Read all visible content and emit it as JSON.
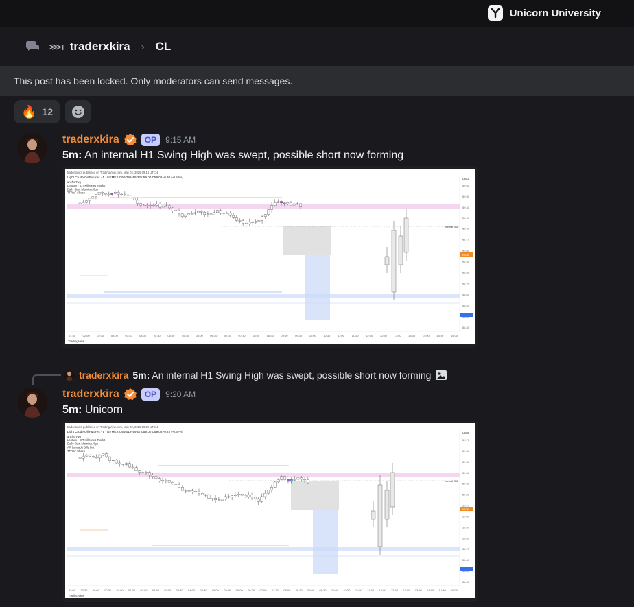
{
  "brand": {
    "name": "Unicorn University"
  },
  "breadcrumb": {
    "thread_glyph": "⋙ ı",
    "channel": "traderxkira",
    "separator": "›",
    "thread": "CL"
  },
  "locked_banner": {
    "text": "This post has been locked. Only moderators can send messages."
  },
  "reactions": [
    {
      "emoji": "🔥",
      "count": "12"
    }
  ],
  "messages": [
    {
      "author": "traderxkira",
      "badge": "OP",
      "time": "9:15 AM",
      "bold": "5m:",
      "text": "An internal H1 Swing High was swept, possible short now forming",
      "chart": {
        "header": "tradersxkira published on TradingView.com, May 02, 2025 09:14 UTC-4",
        "instrument": "Light Crude Oil Futures · 5 · NYMEX  O59.29  H59.32  L59.00  C59.06  -0.30 (-0.51%)",
        "legend": [
          "anchorFvg",
          "Lentum - ICT Killzones Toolkit",
          "Daily Start Morning Algo",
          "TTRaF Shock"
        ],
        "xlabels": [
          "01:30",
          "02:00",
          "02:30",
          "03:00",
          "03:30",
          "04:00",
          "04:30",
          "05:00",
          "05:30",
          "06:00",
          "06:30",
          "07:00",
          "07:30",
          "08:00",
          "08:30",
          "09:00",
          "09:30",
          "10:00",
          "10:30",
          "11:00",
          "11:30",
          "12:00",
          "12:30",
          "13:00",
          "13:30",
          "14:00",
          "14:30",
          "15:00"
        ],
        "ylabels": [
          "59.60",
          "59.50",
          "59.40",
          "59.30",
          "59.20",
          "59.10",
          "59.00",
          "58.90",
          "58.80",
          "58.70",
          "58.60",
          "58.50",
          "58.40",
          "58.30"
        ],
        "internal_label": "internal ERL",
        "footer": "TradingView",
        "usd": "USD",
        "price_tag": "59.06"
      }
    },
    {
      "author": "traderxkira",
      "badge": "OP",
      "time": "9:20 AM",
      "bold": "5m:",
      "text": "Unicorn",
      "reply": {
        "author": "traderxkira",
        "bold": "5m:",
        "text": "An internal H1 Swing High was swept, possible short now forming"
      },
      "chart": {
        "header": "tradersxkira published on TradingView.com, May 02, 2025 09:20 UTC-4",
        "instrument": "Light Crude Oil Futures · 5 · NYMEX  O59.01  H59.07  L59.00  C59.06  -0.22 (-0.37%)",
        "legend": [
          "anchorFvg",
          "Lentum - ICT Killzones Toolkit",
          "Daily Start Morning Algo",
          "AR Lanzado Silly Bot",
          "TTRaF Shock"
        ],
        "xlabels": [
          "22:00",
          "23:30",
          "00:00",
          "00:30",
          "01:00",
          "01:30",
          "02:00",
          "02:30",
          "03:00",
          "03:30",
          "04:00",
          "04:30",
          "05:00",
          "05:30",
          "06:00",
          "06:30",
          "07:00",
          "07:30",
          "08:00",
          "08:30",
          "09:00",
          "09:30",
          "10:00",
          "10:30",
          "11:00",
          "11:30",
          "12:00",
          "12:30",
          "13:00",
          "13:30",
          "14:00",
          "14:30",
          "15:00"
        ],
        "ylabels": [
          "59.70",
          "59.60",
          "59.50",
          "59.40",
          "59.30",
          "59.20",
          "59.10",
          "59.00",
          "58.90",
          "58.80",
          "58.70",
          "58.60",
          "58.50",
          "58.40"
        ],
        "internal_label": "internal ERL",
        "footer": "TradingView",
        "usd": "USD",
        "price_tag": "59.06"
      }
    }
  ],
  "colors": {
    "author": "#f28c38",
    "op_badge": "#5865f2",
    "candle_up": "#ffffff",
    "candle_edge": "#555555",
    "pink_zone": "#f3d6f0",
    "blue_zone": "#dbe6fb",
    "fvg_gray": "#d9d9d9",
    "magenta_candle": "#c04fd6",
    "teal_candle": "#26c6da"
  },
  "icons": [
    "unicorn-logo-icon",
    "forum-channel-icon",
    "thread-icon",
    "chevron-right-icon",
    "fire-emoji",
    "add-reaction-icon",
    "verified-badge-icon",
    "image-icon"
  ]
}
